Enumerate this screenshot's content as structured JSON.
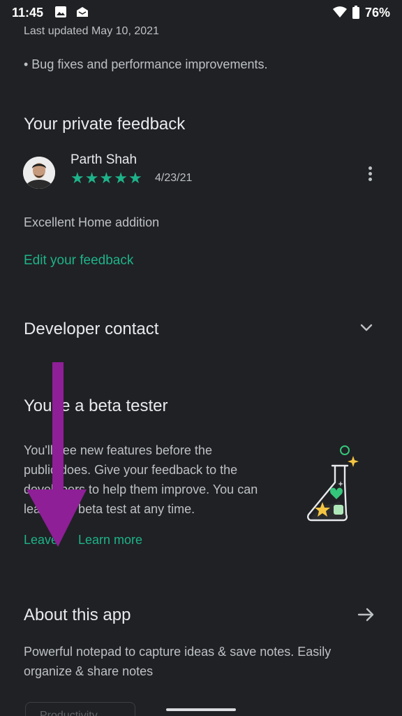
{
  "status_bar": {
    "time": "11:45",
    "battery_percent": "76%",
    "icons": [
      "image-icon",
      "notification-icon",
      "wifi-icon",
      "battery-icon"
    ]
  },
  "whats_new": {
    "last_updated": "Last updated May 10, 2021",
    "notes": "• Bug fixes and performance improvements."
  },
  "private_feedback": {
    "title": "Your private feedback",
    "reviewer_name": "Parth Shah",
    "rating": 5,
    "rating_max": 5,
    "date": "4/23/21",
    "text": "Excellent Home addition",
    "edit_label": "Edit your feedback"
  },
  "developer_contact": {
    "title": "Developer contact"
  },
  "beta": {
    "title": "You're a beta tester",
    "description_lines": [
      "You'll see new features before the",
      "public does. Give your feedback to the",
      "developers to help them improve. You can",
      "leave the beta test at any time."
    ],
    "leave_label": "Leave",
    "learn_more_label": "Learn more"
  },
  "about": {
    "title": "About this app",
    "description_lines": [
      "Powerful notepad to capture ideas & save notes. Easily",
      "organize & share notes"
    ],
    "category_chip": "Productivity"
  },
  "colors": {
    "background": "#202124",
    "accent_green": "#1db38a",
    "annotation_arrow": "#8e1f97",
    "text_primary": "#e8eaed",
    "text_secondary": "#bdc1c6"
  }
}
